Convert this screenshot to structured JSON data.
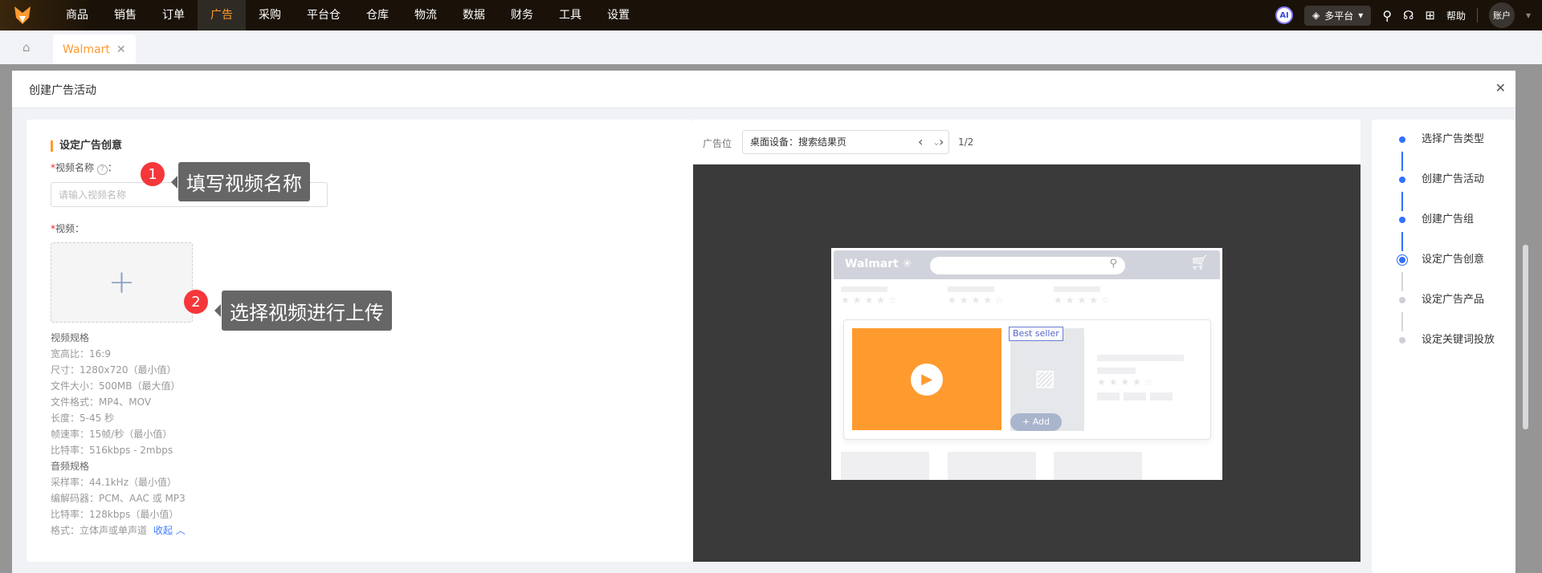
{
  "topnav": {
    "items": [
      "商品",
      "销售",
      "订单",
      "广告",
      "采购",
      "平台仓",
      "仓库",
      "物流",
      "数据",
      "财务",
      "工具",
      "设置"
    ],
    "active": "广告",
    "ai_label": "AI",
    "platform": "多平台",
    "help": "帮助",
    "account": "账户"
  },
  "tabs": {
    "open_tab": "Walmart",
    "close": "✕"
  },
  "modal": {
    "title": "创建广告活动",
    "close": "✕"
  },
  "form": {
    "section_title": "设定广告创意",
    "video_name_label": "视频名称",
    "video_name_placeholder": "请输入视频名称",
    "video_name_value": "",
    "video_label": "视频",
    "upload_icon": "plus-icon",
    "video_specs_title": "视频规格",
    "video_specs": [
      "宽高比：16:9",
      "尺寸：1280x720（最小值）",
      "文件大小：500MB（最大值）",
      "文件格式：MP4、MOV",
      "长度：5-45 秒",
      "帧速率：15帧/秒（最小值）",
      "比特率：516kbps - 2mbps"
    ],
    "audio_specs_title": "音频规格",
    "audio_specs": [
      "采样率：44.1kHz（最小值）",
      "编解码器：PCM、AAC 或 MP3",
      "比特率：128kbps（最小值）",
      "格式：立体声或单声道"
    ],
    "collapse": "收起"
  },
  "annotations": [
    {
      "num": "1",
      "text": "填写视频名称"
    },
    {
      "num": "2",
      "text": "选择视频进行上传"
    }
  ],
  "preview": {
    "placement_label": "广告位",
    "placement_value": "桌面设备：搜索结果页",
    "page": "1/2",
    "mock": {
      "logo": "Walmart",
      "badge": "Best seller",
      "add": "Add"
    }
  },
  "steps": [
    {
      "label": "选择广告类型",
      "status": "done"
    },
    {
      "label": "创建广告活动",
      "status": "done"
    },
    {
      "label": "创建广告组",
      "status": "done"
    },
    {
      "label": "设定广告创意",
      "status": "current"
    },
    {
      "label": "设定广告产品",
      "status": "todo"
    },
    {
      "label": "设定关键词投放",
      "status": "todo"
    }
  ],
  "colors": {
    "accent": "#ff9a2e",
    "primary": "#3370ff",
    "annotation_badge": "#f5363a"
  }
}
